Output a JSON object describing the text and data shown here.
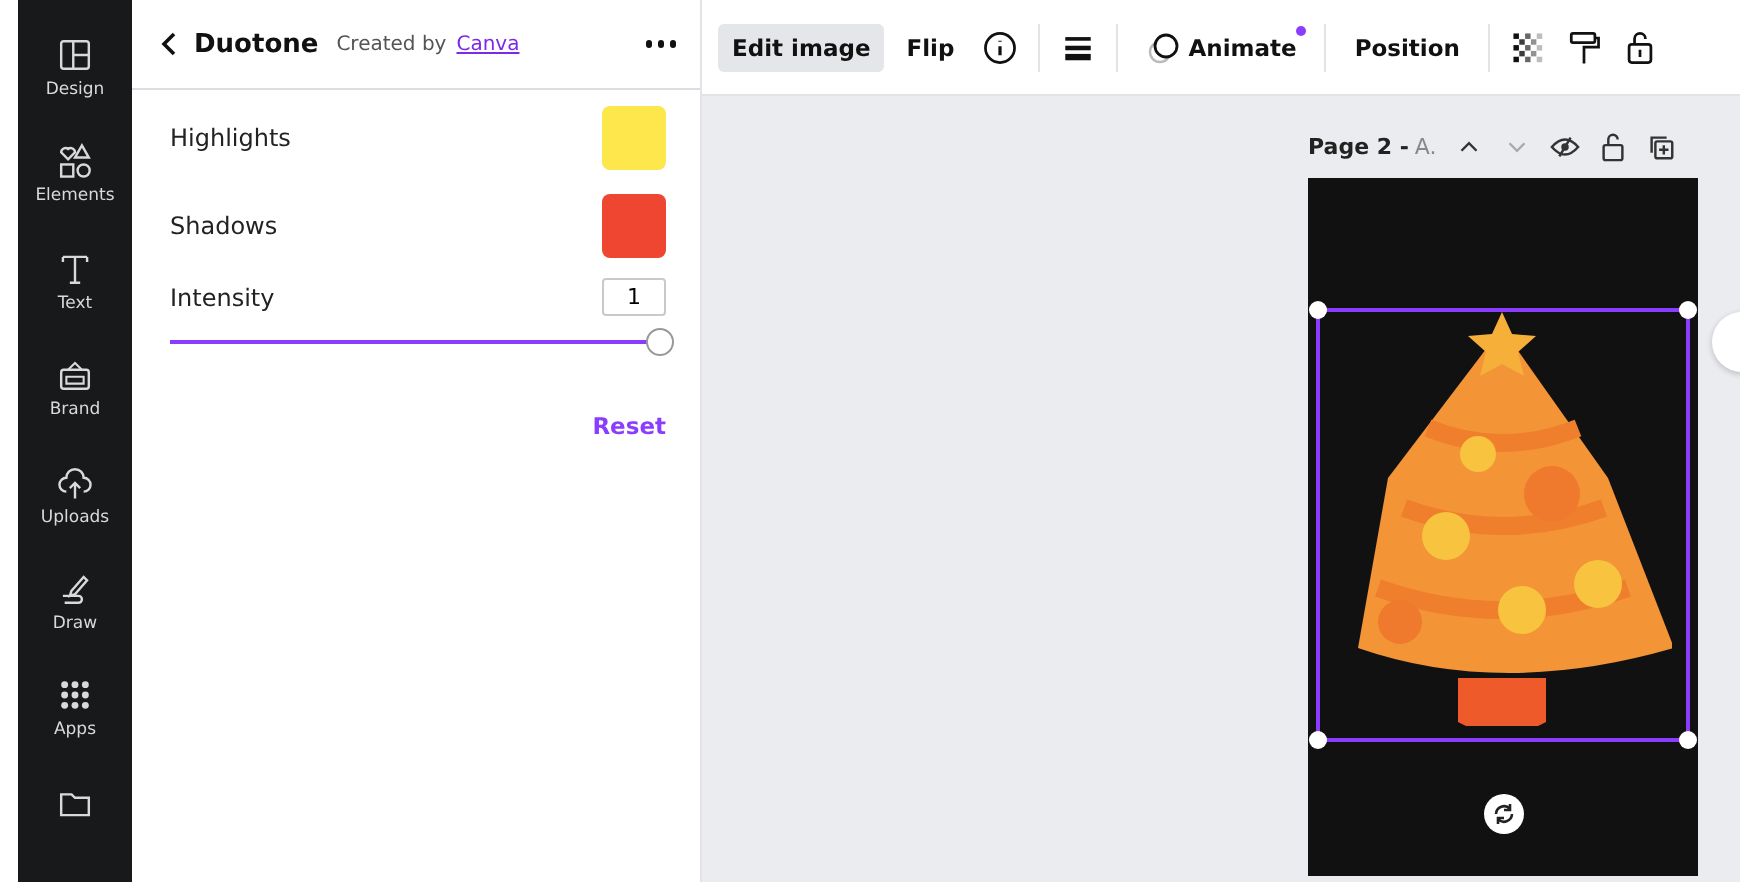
{
  "sidebar": {
    "items": [
      {
        "label": "Design"
      },
      {
        "label": "Elements"
      },
      {
        "label": "Text"
      },
      {
        "label": "Brand"
      },
      {
        "label": "Uploads"
      },
      {
        "label": "Draw"
      },
      {
        "label": "Apps"
      }
    ]
  },
  "panel": {
    "title": "Duotone",
    "credit": "Created by",
    "author": "Canva",
    "colors": [
      {
        "label": "Highlights",
        "color": "#fde74c"
      },
      {
        "label": "Shadows",
        "color": "#ee4630"
      }
    ],
    "intensity": {
      "label": "Intensity",
      "value": "1",
      "level": 1
    },
    "reset": "Reset"
  },
  "toolbar": {
    "items": [
      {
        "label": "Edit image",
        "selected": true
      },
      {
        "label": "Flip",
        "selected": false
      },
      {
        "label": "Animate",
        "selected": false
      },
      {
        "label": "Position",
        "selected": false
      }
    ]
  },
  "page": {
    "label": "Page 2 -",
    "title": "A."
  }
}
